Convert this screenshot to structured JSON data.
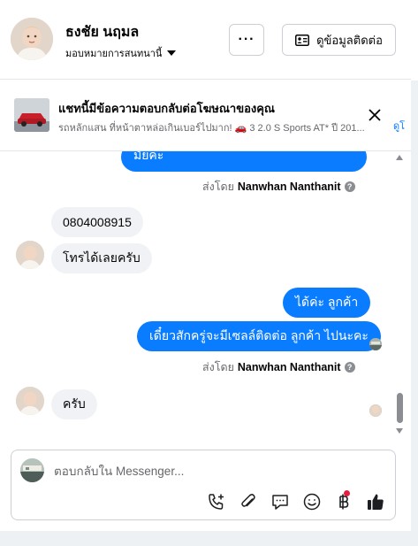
{
  "header": {
    "contact_name": "ธงชัย นฤมล",
    "assign_label": "มอบหมายการสนทนานี้",
    "more_label": "···",
    "view_contact_label": "ดูข้อมูลติดต่อ"
  },
  "ad_banner": {
    "title": "แชทนี้มีข้อความตอบกลับต่อโฆษณาของคุณ",
    "subtitle": "รถหลักแสน ที่หน้าตาหล่อเกินเบอร์ไปมาก! 🚗 3 2.0 S Sports AT* ปี 201...",
    "view_more_label": "ดูโ"
  },
  "messages": {
    "out_1": "มัยคะ",
    "sent_by_1_prefix": "ส่งโดย",
    "sent_by_1_name": "Nanwhan Nanthanit",
    "in_1": "0804008915",
    "in_2": "โทรได้เลยครับ",
    "out_2": "ได้ค่ะ  ลูกค้า",
    "out_3": "เดี๋ยวสักครู่จะมีเซลล์ติดต่อ ลูกค้า  ไปนะคะ",
    "sent_by_2_prefix": "ส่งโดย",
    "sent_by_2_name": "Nanwhan Nanthanit",
    "in_3": "ครับ",
    "info_glyph": "?"
  },
  "composer": {
    "placeholder": "ตอบกลับใน Messenger..."
  },
  "icons": {
    "call": "phone-plus-icon",
    "attach": "paperclip-icon",
    "saved_replies": "chat-bubble-icon",
    "emoji": "smiley-icon",
    "payment": "baht-icon",
    "like": "thumbs-up-icon"
  },
  "colors": {
    "accent": "#0a7cff",
    "incoming_bubble": "#f0f2f5",
    "notification_dot": "#e41e3f"
  }
}
